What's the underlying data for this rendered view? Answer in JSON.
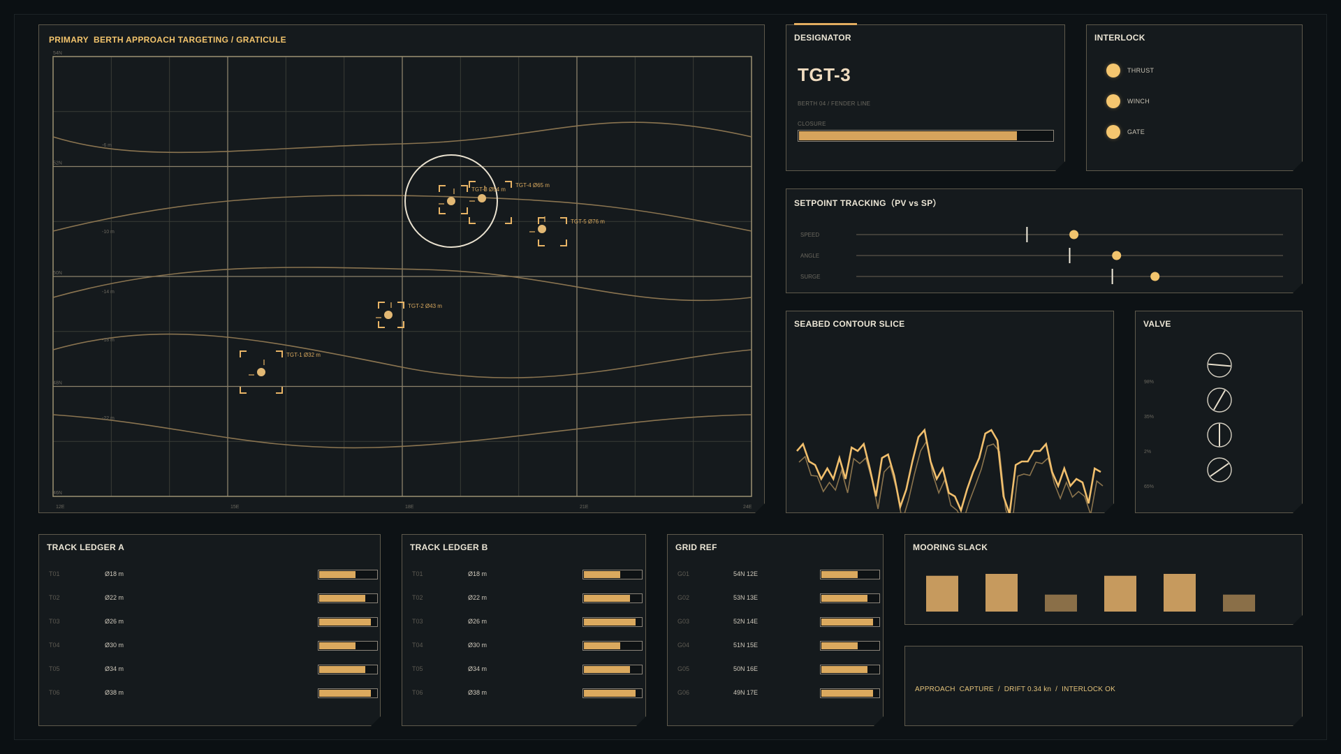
{
  "graticule": {
    "title": "PRIMARY  BERTH APPROACH TARGETING / GRATICULE",
    "lat_labels": [
      "54N",
      "52N",
      "50N",
      "48N",
      "46N"
    ],
    "lon_labels": [
      "12E",
      "15E",
      "18E",
      "21E",
      "24E"
    ],
    "depth_labels": [
      "-6 m",
      "-10 m",
      "-14 m",
      "-18 m",
      "-22 m"
    ],
    "targets": [
      {
        "id": "TGT-1",
        "label": "TGT-1  Ø32 m"
      },
      {
        "id": "TGT-2",
        "label": "TGT-2  Ø43 m"
      },
      {
        "id": "TGT-3",
        "label": "TGT-3  Ø54 m"
      },
      {
        "id": "TGT-4",
        "label": "TGT-4  Ø65 m"
      },
      {
        "id": "TGT-5",
        "label": "TGT-5  Ø76 m"
      }
    ]
  },
  "designator": {
    "title": "DESIGNATOR",
    "target": "TGT-3",
    "subtitle": "BERTH 04 / FENDER LINE",
    "closure_label": "CLOSURE",
    "closure_fraction": 0.86
  },
  "interlock": {
    "title": "INTERLOCK",
    "items": [
      {
        "label": "THRUST"
      },
      {
        "label": "WINCH"
      },
      {
        "label": "GATE"
      }
    ]
  },
  "setpoint": {
    "title": "SETPOINT TRACKING（PV vs SP）",
    "rows": [
      {
        "label": "SPEED",
        "sp": 0.4,
        "pv": 0.51
      },
      {
        "label": "ANGLE",
        "sp": 0.5,
        "pv": 0.61
      },
      {
        "label": "SURGE",
        "sp": 0.6,
        "pv": 0.7
      }
    ]
  },
  "seabed": {
    "title": "SEABED CONTOUR SLICE"
  },
  "valve": {
    "title": "VALVE",
    "items": [
      {
        "label": "98%",
        "angle": 95
      },
      {
        "label": "35%",
        "angle": 30
      },
      {
        "label": "2%",
        "angle": 0
      },
      {
        "label": "65%",
        "angle": 55
      }
    ]
  },
  "ledger_a": {
    "title": "TRACK LEDGER A",
    "rows": [
      {
        "id": "T01",
        "value": "Ø18 m",
        "fraction": 0.64
      },
      {
        "id": "T02",
        "value": "Ø22 m",
        "fraction": 0.8
      },
      {
        "id": "T03",
        "value": "Ø26 m",
        "fraction": 0.9
      },
      {
        "id": "T04",
        "value": "Ø30 m",
        "fraction": 0.64
      },
      {
        "id": "T05",
        "value": "Ø34 m",
        "fraction": 0.8
      },
      {
        "id": "T06",
        "value": "Ø38 m",
        "fraction": 0.9
      }
    ]
  },
  "ledger_b": {
    "title": "TRACK LEDGER B",
    "rows": [
      {
        "id": "T01",
        "value": "Ø18 m",
        "fraction": 0.64
      },
      {
        "id": "T02",
        "value": "Ø22 m",
        "fraction": 0.8
      },
      {
        "id": "T03",
        "value": "Ø26 m",
        "fraction": 0.9
      },
      {
        "id": "T04",
        "value": "Ø30 m",
        "fraction": 0.64
      },
      {
        "id": "T05",
        "value": "Ø34 m",
        "fraction": 0.8
      },
      {
        "id": "T06",
        "value": "Ø38 m",
        "fraction": 0.9
      }
    ]
  },
  "grid_ref": {
    "title": "GRID REF",
    "rows": [
      {
        "id": "G01",
        "value": "54N 12E",
        "fraction": 0.64
      },
      {
        "id": "G02",
        "value": "53N 13E",
        "fraction": 0.8
      },
      {
        "id": "G03",
        "value": "52N 14E",
        "fraction": 0.9
      },
      {
        "id": "G04",
        "value": "51N 15E",
        "fraction": 0.64
      },
      {
        "id": "G05",
        "value": "50N 16E",
        "fraction": 0.8
      },
      {
        "id": "G06",
        "value": "49N 17E",
        "fraction": 0.9
      }
    ]
  },
  "mooring": {
    "title": "MOORING SLACK",
    "levels": [
      0.95,
      1.0,
      0.45,
      0.95,
      1.0,
      0.45
    ],
    "bright_color": "#c69a5e",
    "dim_color": "#8a6f48"
  },
  "status": {
    "text": "APPROACH  CAPTURE  /  DRIFT 0.34 kn  /  INTERLOCK OK"
  }
}
